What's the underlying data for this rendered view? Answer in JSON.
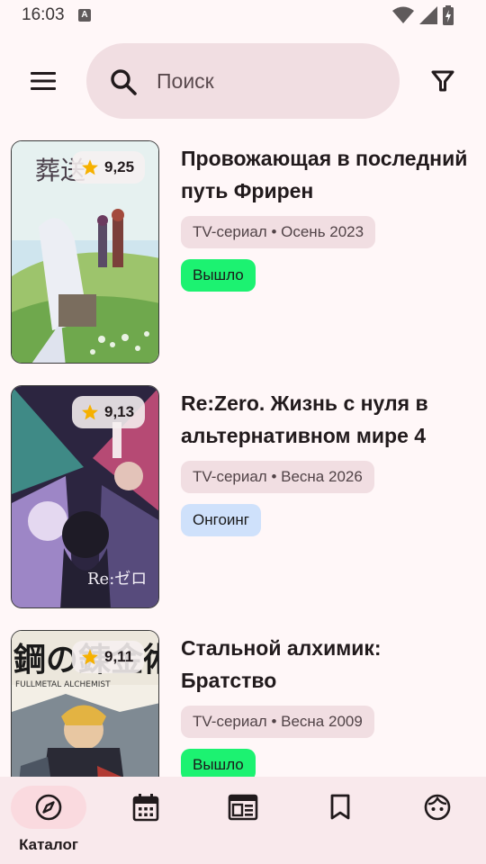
{
  "status_bar": {
    "time": "16:03",
    "notification_glyph": "A"
  },
  "search": {
    "placeholder": "Поиск"
  },
  "icons": {
    "menu": "menu-icon",
    "search": "search-icon",
    "filter": "filter-icon"
  },
  "items": [
    {
      "title": "Провожающая в последний путь Фрирен",
      "rating": "9,25",
      "meta": "TV-сериал • Осень 2023",
      "status": "Вышло",
      "status_color": "#1CF271"
    },
    {
      "title": "Re:Zero. Жизнь с нуля в альтернативном мире 4",
      "rating": "9,13",
      "meta": "TV-сериал • Весна 2026",
      "status": "Онгоинг",
      "status_color": "#CFE1FB"
    },
    {
      "title": "Стальной алхимик: Братство",
      "rating": "9,11",
      "meta": "TV-сериал • Весна 2009",
      "status": "Вышло",
      "status_color": "#1CF271"
    }
  ],
  "bottom_nav": [
    {
      "label": "Каталог",
      "icon": "compass-icon",
      "active": true
    },
    {
      "label": "",
      "icon": "calendar-icon",
      "active": false
    },
    {
      "label": "",
      "icon": "news-icon",
      "active": false
    },
    {
      "label": "",
      "icon": "bookmark-icon",
      "active": false
    },
    {
      "label": "",
      "icon": "profile-icon",
      "active": false
    }
  ],
  "colors": {
    "background": "#FFF7F8",
    "search_bg": "#F1DEE2",
    "nav_bg": "#F9E9EC",
    "nav_active": "#FADADF",
    "star": "#F6B100"
  }
}
